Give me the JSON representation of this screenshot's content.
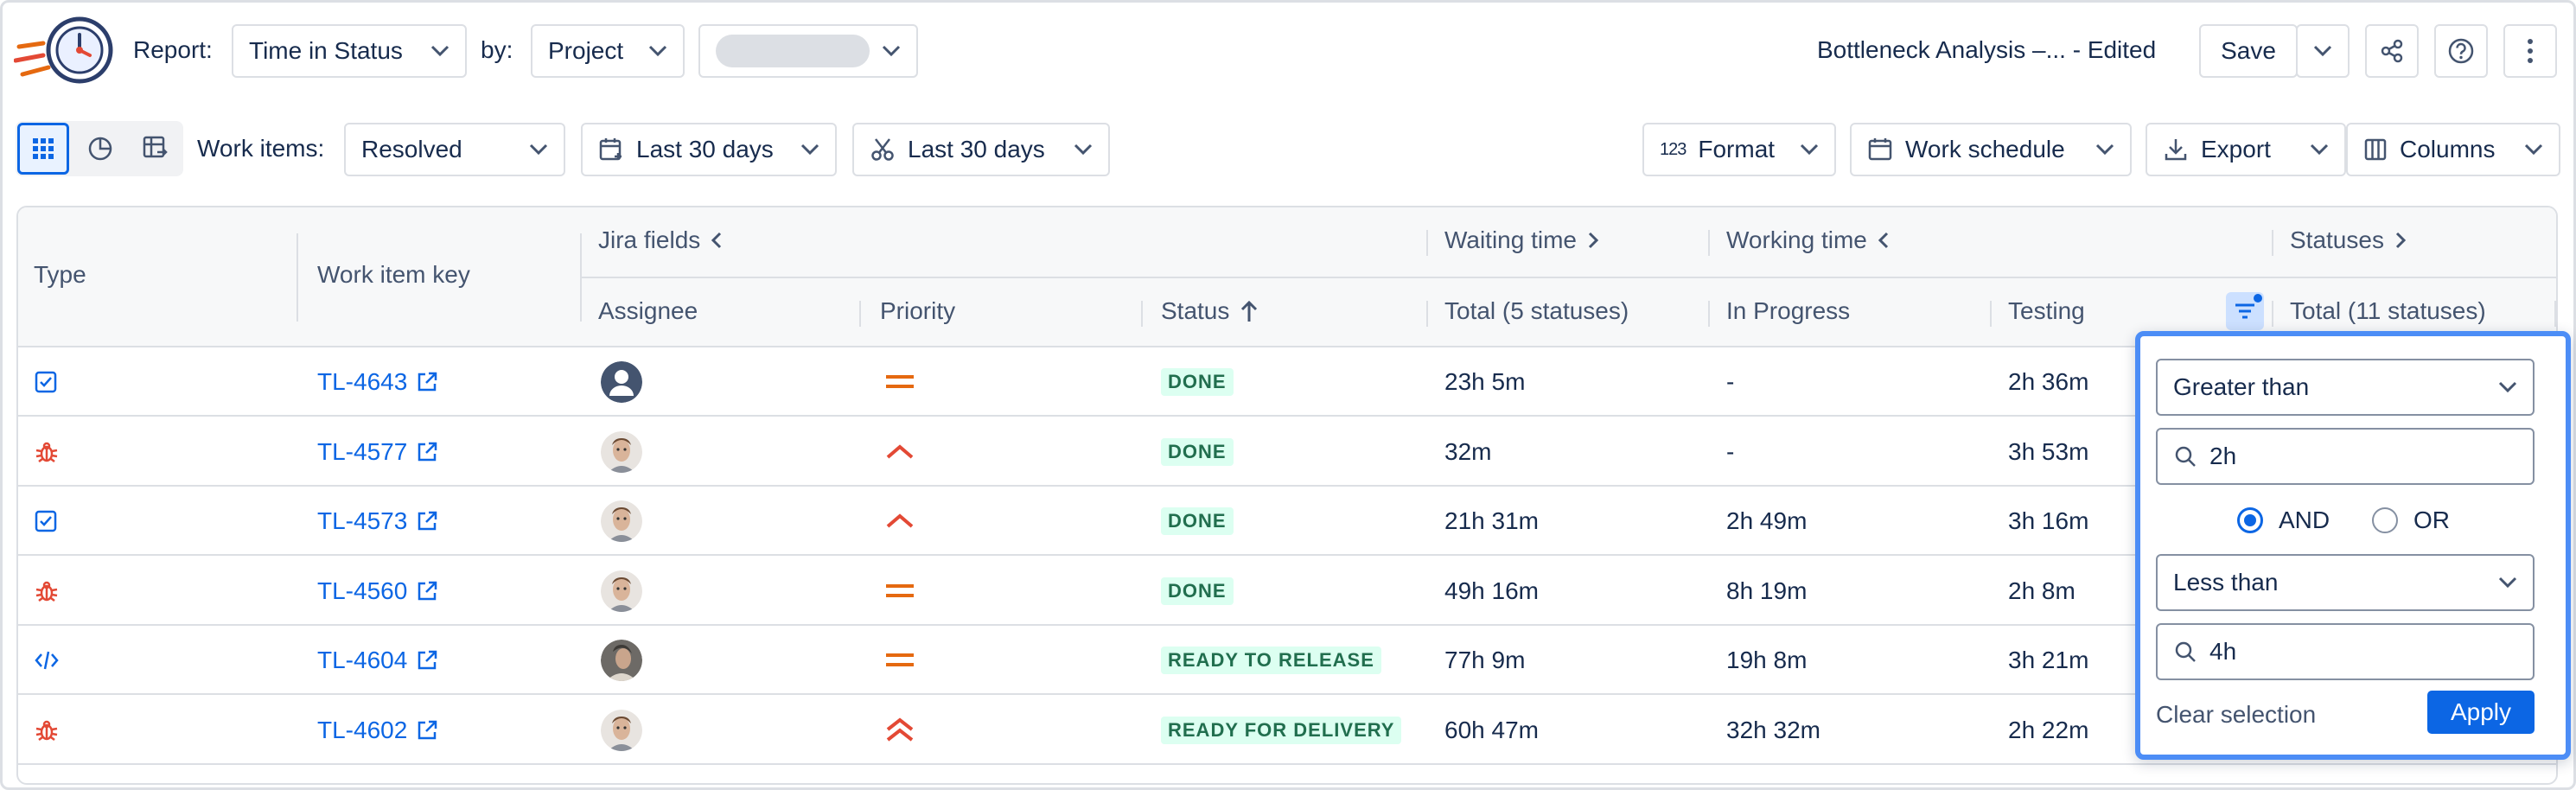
{
  "toolbar": {
    "report_label": "Report:",
    "report_value": "Time in Status",
    "by_label": "by:",
    "by_value": "Project",
    "project_value": "",
    "report_name": "Bottleneck Analysis –... - Edited",
    "save_label": "Save"
  },
  "filters": {
    "work_items_label": "Work items:",
    "work_items_value": "Resolved",
    "created_range": "Last 30 days",
    "resolved_range": "Last 30 days",
    "format_label": "Format",
    "format_icon_text": "123",
    "work_schedule_label": "Work schedule",
    "export_label": "Export",
    "columns_label": "Columns"
  },
  "table": {
    "groups": {
      "jira_fields": "Jira fields",
      "waiting_time": "Waiting time",
      "working_time": "Working time",
      "statuses": "Statuses"
    },
    "headers": {
      "type": "Type",
      "key": "Work item key",
      "assignee": "Assignee",
      "priority": "Priority",
      "status": "Status",
      "waiting_total": "Total (5 statuses)",
      "in_progress": "In Progress",
      "testing": "Testing",
      "statuses_total": "Total (11 statuses)"
    },
    "rows": [
      {
        "type": "task",
        "key": "TL-4643",
        "avatar": "default",
        "priority": "medium",
        "status": "DONE",
        "waiting": "23h 5m",
        "in_progress": "-",
        "testing": "2h 36m"
      },
      {
        "type": "bug",
        "key": "TL-4577",
        "avatar": "person",
        "priority": "high",
        "status": "DONE",
        "waiting": "32m",
        "in_progress": "-",
        "testing": "3h 53m"
      },
      {
        "type": "task",
        "key": "TL-4573",
        "avatar": "person",
        "priority": "high",
        "status": "DONE",
        "waiting": "21h 31m",
        "in_progress": "2h 49m",
        "testing": "3h 16m"
      },
      {
        "type": "bug",
        "key": "TL-4560",
        "avatar": "person",
        "priority": "medium",
        "status": "DONE",
        "waiting": "49h 16m",
        "in_progress": "8h 19m",
        "testing": "2h 8m"
      },
      {
        "type": "code",
        "key": "TL-4604",
        "avatar": "person2",
        "priority": "medium",
        "status": "READY TO RELEASE",
        "waiting": "77h 9m",
        "in_progress": "19h 8m",
        "testing": "3h 21m"
      },
      {
        "type": "bug",
        "key": "TL-4602",
        "avatar": "person",
        "priority": "highest",
        "status": "READY FOR DELIVERY",
        "waiting": "60h 47m",
        "in_progress": "32h 32m",
        "testing": "2h 22m"
      }
    ]
  },
  "filter_popup": {
    "condition1": "Greater than",
    "value1": "2h",
    "and_label": "AND",
    "or_label": "OR",
    "selected_logic": "AND",
    "condition2": "Less than",
    "value2": "4h",
    "clear_label": "Clear selection",
    "apply_label": "Apply"
  },
  "colors": {
    "accent": "#0c66e4",
    "bug": "#e34935",
    "priority_medium": "#e56910",
    "priority_high": "#e34935",
    "lozenge_bg": "#dcfff1",
    "lozenge_text": "#216e4e"
  }
}
